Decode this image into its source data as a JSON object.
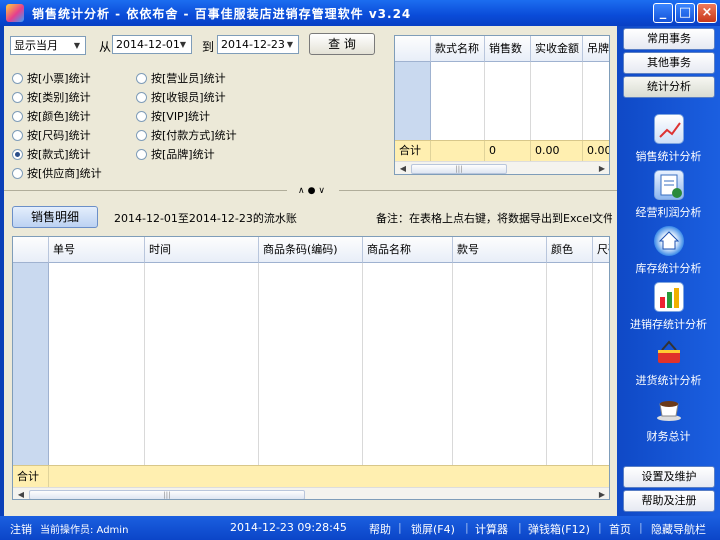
{
  "window": {
    "title": "销售统计分析 - 依依布舍 - 百事佳服装店进销存管理软件 v3.24",
    "buttons": {
      "minimize": "_",
      "maximize": "□",
      "close": "×"
    }
  },
  "filter": {
    "period": "显示当月",
    "from_label": "从",
    "from_date": "2014-12-01",
    "to_label": "到",
    "to_date": "2014-12-23",
    "query_label": "查 询"
  },
  "stat_options": [
    {
      "label": "按[小票]统计",
      "selected": false
    },
    {
      "label": "按[类别]统计",
      "selected": false
    },
    {
      "label": "按[颜色]统计",
      "selected": false
    },
    {
      "label": "按[尺码]统计",
      "selected": false
    },
    {
      "label": "按[款式]统计",
      "selected": true
    },
    {
      "label": "按[供应商]统计",
      "selected": false
    },
    {
      "label": "按[营业员]统计",
      "selected": false
    },
    {
      "label": "按[收银员]统计",
      "selected": false
    },
    {
      "label": "按[VIP]统计",
      "selected": false
    },
    {
      "label": "按[付款方式]统计",
      "selected": false
    },
    {
      "label": "按[品牌]统计",
      "selected": false
    }
  ],
  "summary_grid": {
    "columns": [
      "款式名称",
      "销售数",
      "实收金额",
      "吊牌"
    ],
    "total_label": "合计",
    "totals": [
      "",
      "0",
      "0.00",
      "0.00"
    ],
    "scroll_thumb": "|||"
  },
  "splitter_controls": "∧●∨",
  "detail": {
    "tab_label": "销售明细",
    "range_text": "2014-12-01至2014-12-23的流水账",
    "note": "备注：在表格上点右键，将数据导出到Excel文件。",
    "columns": [
      "单号",
      "时间",
      "商品条码(编码)",
      "商品名称",
      "款号",
      "颜色",
      "尺码"
    ],
    "total_label": "合计",
    "scroll_thumb": "|||"
  },
  "sidebar": {
    "top_buttons": [
      {
        "label": "常用事务",
        "active": false
      },
      {
        "label": "其他事务",
        "active": false
      },
      {
        "label": "统计分析",
        "active": true
      }
    ],
    "nav": [
      {
        "label": "销售统计分析",
        "icon": "sales-chart-icon"
      },
      {
        "label": "经营利润分析",
        "icon": "profit-report-icon"
      },
      {
        "label": "库存统计分析",
        "icon": "warehouse-home-icon"
      },
      {
        "label": "进销存统计分析",
        "icon": "bar-chart-icon"
      },
      {
        "label": "进货统计分析",
        "icon": "shopping-basket-icon"
      },
      {
        "label": "财务总计",
        "icon": "coffee-cup-icon"
      }
    ],
    "bottom_buttons": [
      "设置及维护",
      "帮助及注册"
    ]
  },
  "status_bar": {
    "logout": "注销",
    "operator": "当前操作员: Admin",
    "datetime": "2014-12-23  09:28:45",
    "links": [
      "帮助",
      "锁屏(F4)",
      "计算器",
      "弹钱箱(F12)",
      "首页",
      "隐藏导航栏"
    ]
  }
}
